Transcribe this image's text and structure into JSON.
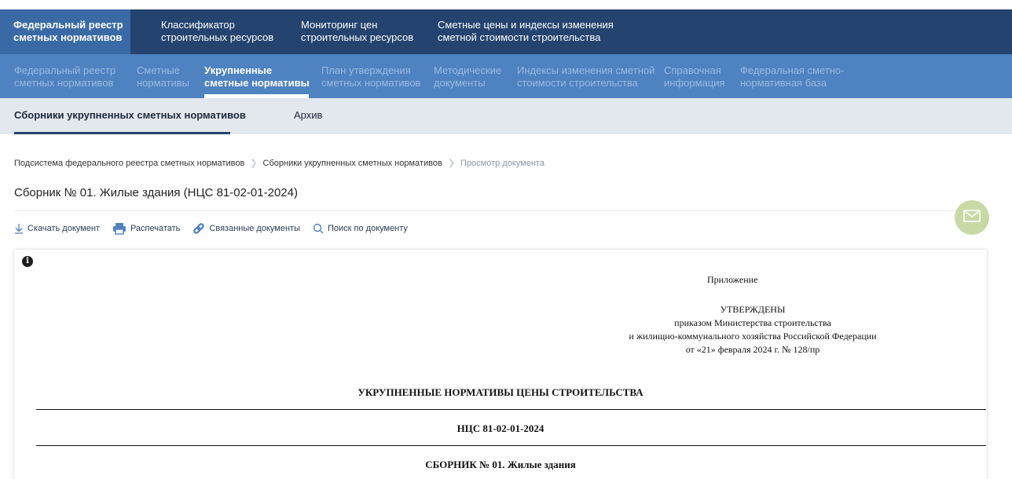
{
  "top_nav": [
    {
      "line1": "Федеральный реестр",
      "line2": "сметных нормативов"
    },
    {
      "line1": "Классификатор",
      "line2": "строительных ресурсов"
    },
    {
      "line1": "Мониторинг цен",
      "line2": "строительных ресурсов"
    },
    {
      "line1": "Сметные цены и индексы изменения",
      "line2": "сметной стоимости строительства"
    }
  ],
  "sub_nav": [
    {
      "line1": "Федеральный реестр",
      "line2": "сметных нормативов"
    },
    {
      "line1": "Сметные",
      "line2": "нормативы"
    },
    {
      "line1": "Укрупненные",
      "line2": "сметные нормативы"
    },
    {
      "line1": "План утверждения",
      "line2": "сметных нормативов"
    },
    {
      "line1": "Методические",
      "line2": "документы"
    },
    {
      "line1": "Индексы изменения сметной",
      "line2": "стоимости строительства"
    },
    {
      "line1": "Справочная",
      "line2": "информация"
    },
    {
      "line1": "Федеральная сметно-",
      "line2": "нормативная база"
    }
  ],
  "tabs": [
    "Сборники укрупненных сметных нормативов",
    "Архив"
  ],
  "breadcrumb": {
    "items": [
      "Подсистема федерального реестра сметных нормативов",
      "Сборники укрупненных сметных нормативов"
    ],
    "current": "Просмотр документа"
  },
  "page_title": "Сборник № 01. Жилые здания (НЦС 81-02-01-2024)",
  "toolbar": {
    "download": "Скачать документ",
    "print": "Распечатать",
    "related": "Связанные документы",
    "search": "Поиск по документу"
  },
  "document": {
    "appendix": "Приложение",
    "approved_lines": [
      "УТВЕРЖДЕНЫ",
      "приказом Министерства строительства",
      "и жилищно-коммунального хозяйства Российской Федерации",
      "от «21» февраля 2024 г. № 128/пр"
    ],
    "heading": "УКРУПНЕННЫЕ НОРМАТИВЫ ЦЕНЫ СТРОИТЕЛЬСТВА",
    "code": "НЦС 81-02-01-2024",
    "collection": "СБОРНИК № 01. Жилые здания"
  },
  "colors": {
    "top_nav_bg": "#24446f",
    "top_nav_active": "#3a6aa6",
    "sub_nav_bg": "#4f82c1",
    "tabs_bg": "#e3e7ee",
    "mail_button": "#c9d9a6"
  }
}
